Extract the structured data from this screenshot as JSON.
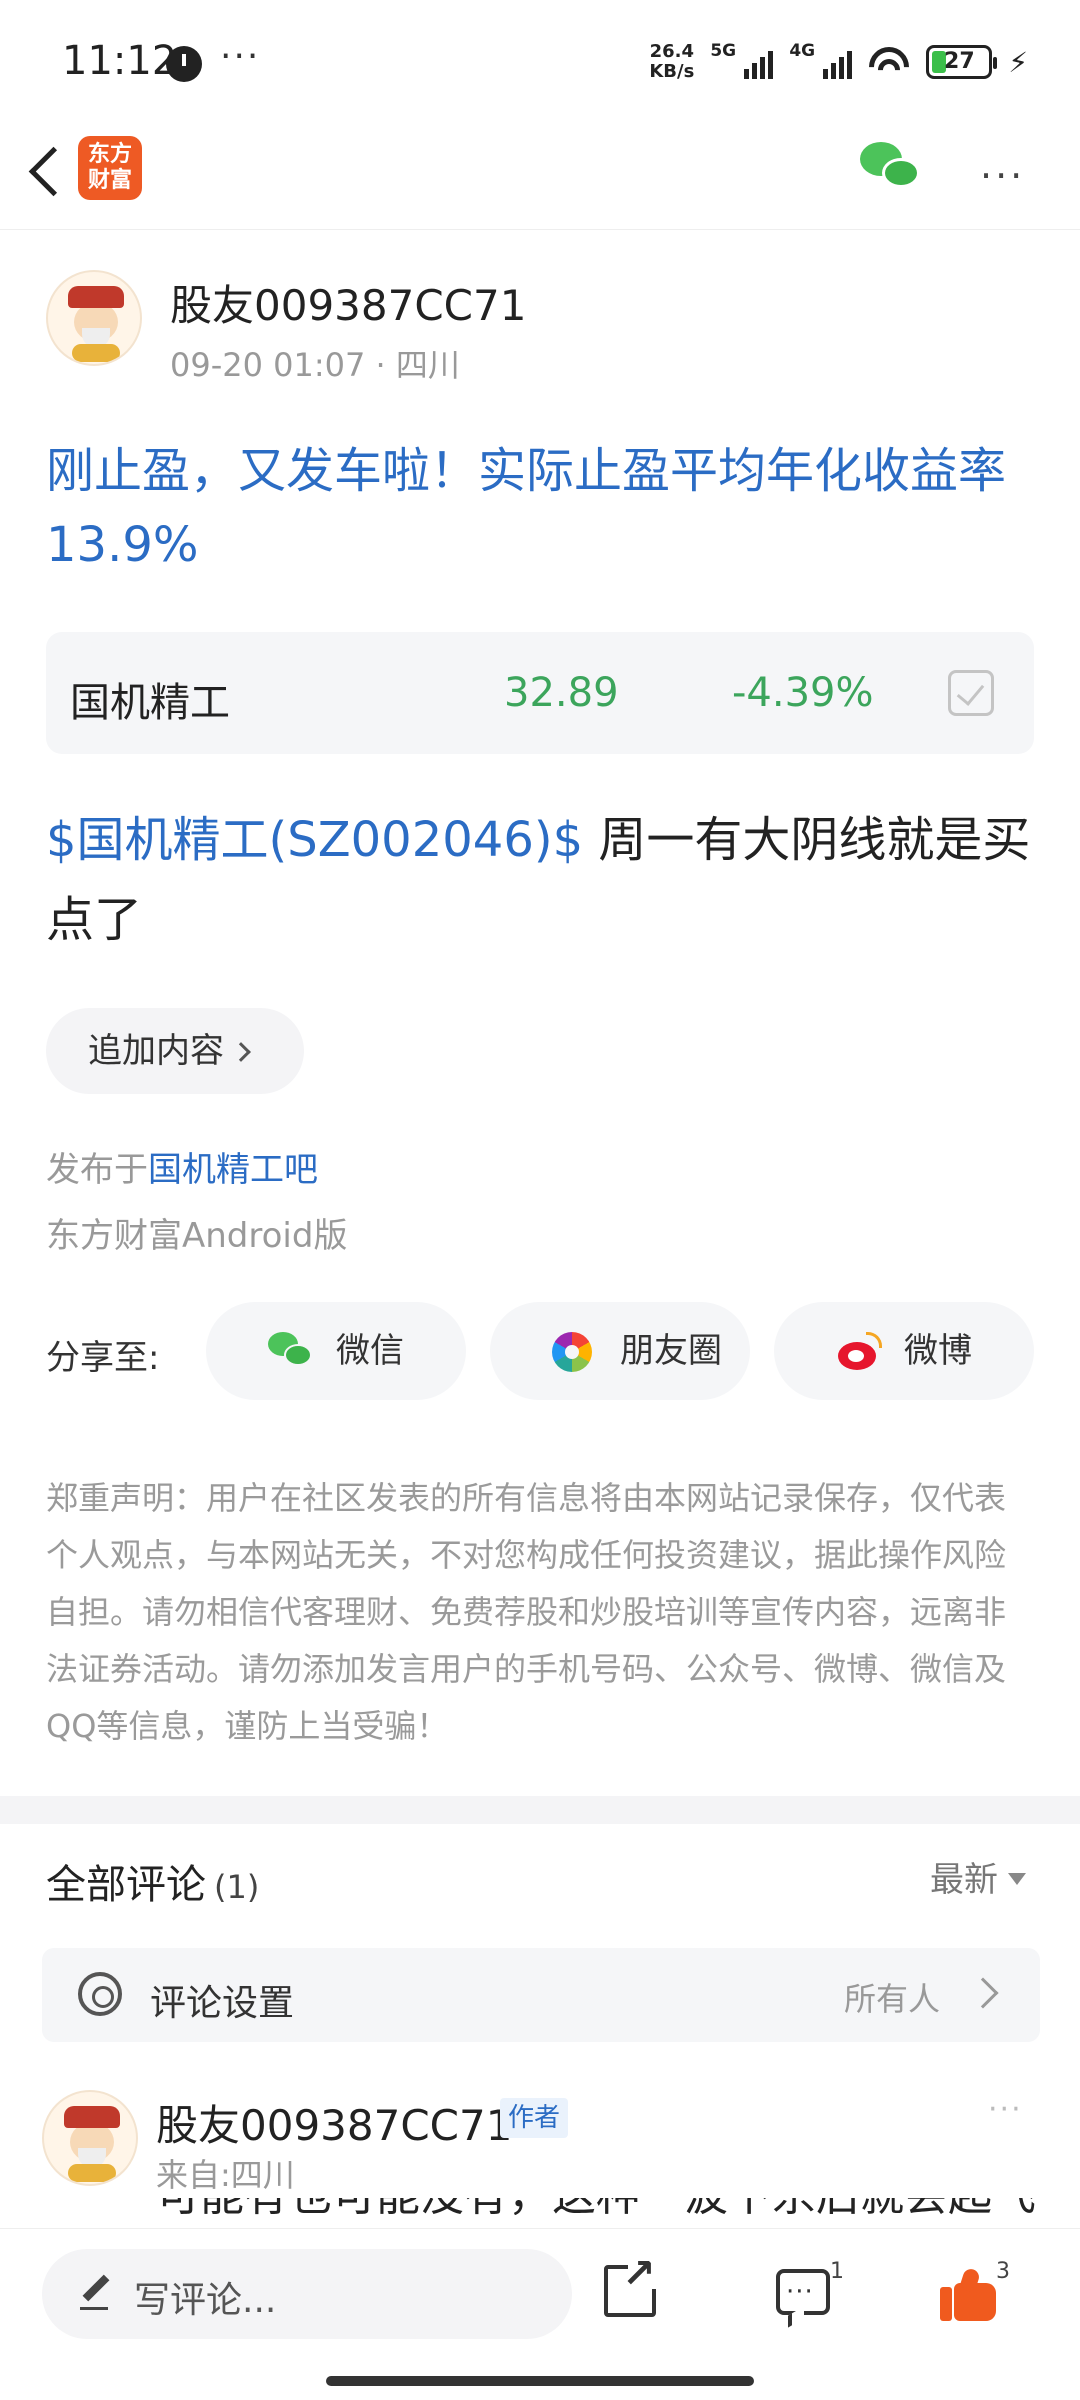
{
  "status_bar": {
    "time": "11:12",
    "more": "···",
    "net_speed_value": "26.4",
    "net_speed_unit": "KB/s",
    "sim1": "5G",
    "sim2": "4G",
    "wifi_label": "6",
    "battery": "27"
  },
  "nav": {
    "logo_line1": "东方",
    "logo_line2": "财富",
    "more": "···"
  },
  "post": {
    "author": "股友009387CC71",
    "date": "09-20 01:07",
    "location": "四川",
    "title": "刚止盈，又发车啦！实际止盈平均年化收益率 13.9%",
    "stock": {
      "name": "国机精工",
      "price": "32.89",
      "change": "-4.39%"
    },
    "body_link": "$国机精工(SZ002046)$",
    "body_text": " 周一有大阴线就是买点了",
    "append_label": "追加内容",
    "published_prefix": "发布于",
    "published_bar": "国机精工吧",
    "client": "东方财富Android版"
  },
  "share": {
    "label": "分享至:",
    "wechat": "微信",
    "moments": "朋友圈",
    "weibo": "微博"
  },
  "disclaimer": "郑重声明：用户在社区发表的所有信息将由本网站记录保存，仅代表个人观点，与本网站无关，不对您构成任何投资建议，据此操作风险自担。请勿相信代客理财、免费荐股和炒股培训等宣传内容，远离非法证券活动。请勿添加发言用户的手机号码、公众号、微博、微信及QQ等信息，谨防上当受骗！",
  "comments": {
    "header": "全部评论",
    "count": "(1)",
    "sort": "最新",
    "settings_label": "评论设置",
    "settings_value": "所有人",
    "items": [
      {
        "author": "股友009387CC71",
        "badge": "作者",
        "location": "来自:四川",
        "text": "可能有也可能没有，这种一波下杀后就会起飞"
      }
    ]
  },
  "bottom_bar": {
    "input_placeholder": "写评论...",
    "comment_count": "1",
    "like_count": "3"
  },
  "colors": {
    "link_blue": "#2b6cc4",
    "stock_green": "#3ca55c",
    "like_orange": "#f05a1e",
    "logo_orange": "#ee5a24"
  }
}
